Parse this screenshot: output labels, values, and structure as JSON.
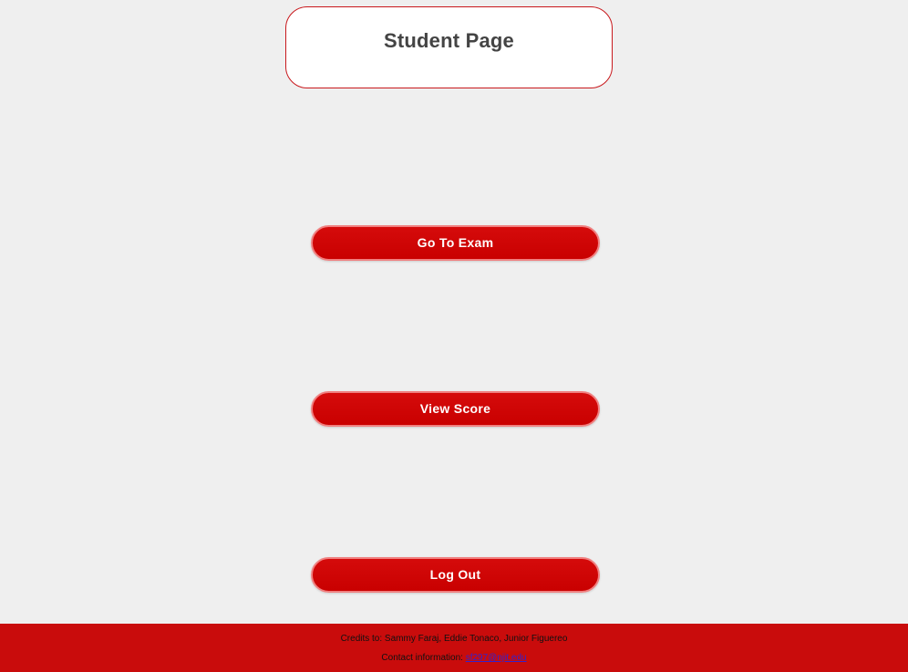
{
  "header": {
    "title": "Student Page"
  },
  "actions": {
    "go_to_exam": "Go To Exam",
    "view_score": "View Score",
    "log_out": "Log Out"
  },
  "footer": {
    "credits": "Credits to: Sammy Faraj, Eddie Tonaco, Junior Figuereo",
    "contact_label": "Contact information:",
    "contact_email": "sf297@njit.edu"
  },
  "colors": {
    "background": "#efefef",
    "accent": "#c90000",
    "title_text": "#444444",
    "link": "#3322cc"
  }
}
